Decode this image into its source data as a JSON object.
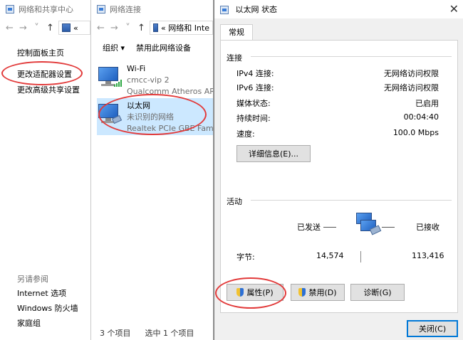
{
  "win1": {
    "title": "网络和共享中心",
    "addr_text": "«  ",
    "links": [
      "控制面板主页",
      "更改适配器设置",
      "更改高级共享设置"
    ],
    "see_also": "另请参阅",
    "see_also_links": [
      "Internet 选项",
      "Windows 防火墙",
      "家庭组"
    ]
  },
  "win2": {
    "title": "网络连接",
    "addr_text": "«  网络和 Inte",
    "toolbar": {
      "organize": "组织 ▾",
      "disable": "禁用此网络设备"
    },
    "items": [
      {
        "name": "Wi-Fi",
        "line2": "cmcc-vip  2",
        "line3": "Qualcomm Atheros AR"
      },
      {
        "name": "以太网",
        "line2": "未识别的网络",
        "line3": "Realtek PCIe GBE Fam"
      }
    ],
    "status": {
      "count": "3 个项目",
      "selected": "选中 1 个项目"
    }
  },
  "dialog": {
    "title": "以太网 状态",
    "tab": "常规",
    "connection_title": "连接",
    "rows": [
      {
        "label": "IPv4 连接:",
        "value": "无网络访问权限"
      },
      {
        "label": "IPv6 连接:",
        "value": "无网络访问权限"
      },
      {
        "label": "媒体状态:",
        "value": "已启用"
      },
      {
        "label": "持续时间:",
        "value": "00:04:40"
      },
      {
        "label": "速度:",
        "value": "100.0 Mbps"
      }
    ],
    "details_button": "详细信息(E)...",
    "activity_title": "活动",
    "sent_label": "已发送",
    "received_label": "已接收",
    "bytes_label": "字节:",
    "bytes_sent": "14,574",
    "bytes_received": "113,416",
    "properties_button": "属性(P)",
    "disable_button": "禁用(D)",
    "diagnose_button": "诊断(G)",
    "close_button": "关闭(C)"
  },
  "colors": {
    "highlight_ring": "#e23a3a",
    "selection": "#cce8ff",
    "link": "#1a3d7c"
  }
}
